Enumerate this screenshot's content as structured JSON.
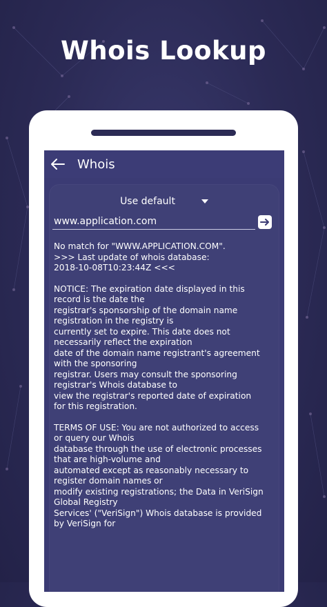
{
  "promo": {
    "headline": "Whois Lookup"
  },
  "appbar": {
    "title": "Whois",
    "back_icon": "arrow-left-icon"
  },
  "server_select": {
    "selected": "Use default",
    "icon": "caret-down-icon"
  },
  "search": {
    "value": "www.application.com",
    "go_icon": "arrow-right-box-icon"
  },
  "result": {
    "paragraphs": [
      "No match for \"WWW.APPLICATION.COM\".\n>>> Last update of whois database:\n2018-10-08T10:23:44Z <<<",
      "NOTICE: The expiration date displayed in this\nrecord is the date the\nregistrar's sponsorship of the domain name\nregistration in the registry is\ncurrently set to expire. This date does not\nnecessarily reflect the expiration\ndate of the domain name registrant's agreement\nwith the sponsoring\nregistrar.  Users may consult the sponsoring\nregistrar's Whois database to\nview the registrar's reported date of expiration\nfor this registration.",
      "TERMS OF USE: You are not authorized to access\nor query our Whois\ndatabase through the use of electronic processes\nthat are high-volume and\nautomated except as reasonably necessary to\nregister domain names or\nmodify existing registrations; the Data in VeriSign\nGlobal Registry\nServices' (\"VeriSign\") Whois database is provided\nby VeriSign for"
    ]
  },
  "colors": {
    "background": "#2b2a55",
    "screen": "#3b3b74",
    "card": "#3f4076",
    "text": "#ffffff"
  }
}
